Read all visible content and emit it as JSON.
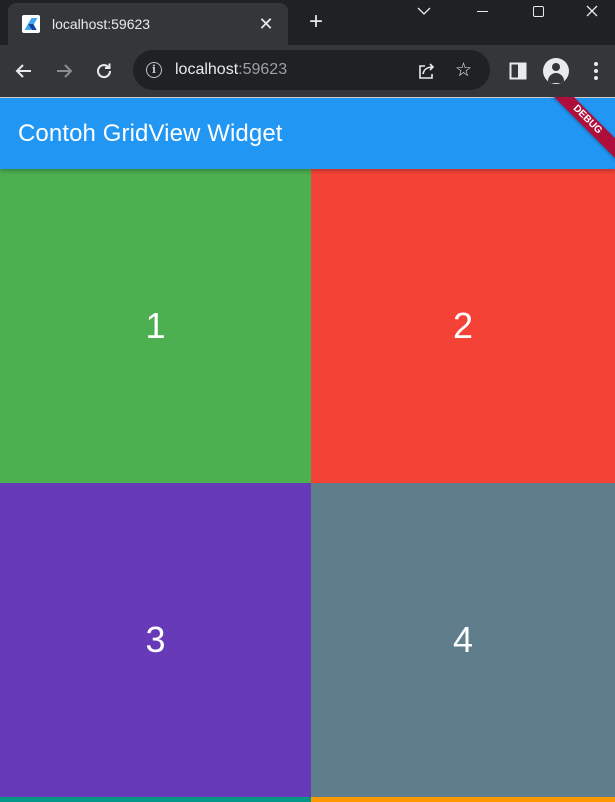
{
  "browser": {
    "tab": {
      "title": "localhost:59623",
      "favicon": "flutter-icon"
    },
    "address": {
      "host": "localhost",
      "port": ":59623"
    },
    "colors": {
      "frame": "#202124",
      "toolbar": "#35363a"
    }
  },
  "app": {
    "title": "Contoh GridView Widget",
    "debug_banner": "DEBUG",
    "colors": {
      "appbar": "#2196f3",
      "banner": "#b00e3a"
    }
  },
  "grid": {
    "tiles": [
      {
        "label": "1",
        "color": "#4caf50"
      },
      {
        "label": "2",
        "color": "#f44336"
      },
      {
        "label": "3",
        "color": "#673ab7"
      },
      {
        "label": "4",
        "color": "#607d8b"
      },
      {
        "label": "",
        "color": "#009688"
      },
      {
        "label": "",
        "color": "#ff9800"
      }
    ]
  }
}
